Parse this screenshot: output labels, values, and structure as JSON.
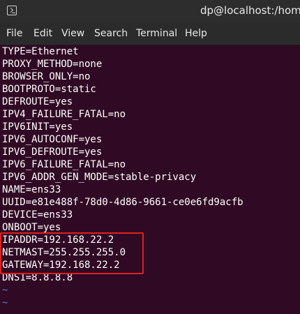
{
  "window": {
    "title": "dp@localhost:/home/"
  },
  "menu": [
    "File",
    "Edit",
    "View",
    "Search",
    "Terminal",
    "Help"
  ],
  "file_lines": [
    "TYPE=Ethernet",
    "PROXY_METHOD=none",
    "BROWSER_ONLY=no",
    "BOOTPROTO=static",
    "DEFROUTE=yes",
    "IPV4_FAILURE_FATAL=no",
    "IPV6INIT=yes",
    "IPV6_AUTOCONF=yes",
    "IPV6_DEFROUTE=yes",
    "IPV6_FAILURE_FATAL=no",
    "IPV6_ADDR_GEN_MODE=stable-privacy",
    "NAME=ens33",
    "UUID=e81e488f-78d0-4d86-9661-ce0e6fd9acfb",
    "DEVICE=ens33",
    "ONBOOT=yes",
    "IPADDR=192.168.22.2",
    "NETMAST=255.255.255.0",
    "GATEWAY=192.168.22.2",
    "DNS1=8.8.8.8",
    "~",
    "~"
  ],
  "colors": {
    "terminal_background": "#300a24",
    "text": "#ffffff",
    "tilde": "#4d7fd6",
    "highlight_border": "#e02020"
  },
  "icons": {
    "app_icon": "terminal-icon"
  }
}
